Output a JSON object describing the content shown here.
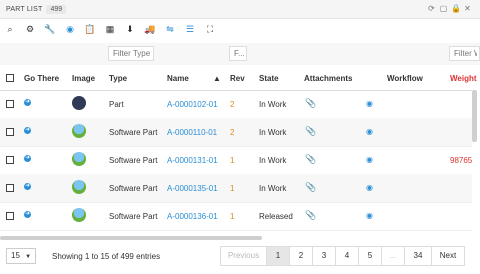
{
  "window": {
    "title": "PART LIST",
    "count": "499"
  },
  "toolbar": {
    "icons": [
      "search-icon",
      "gear-icon",
      "wrench-icon",
      "eye-icon",
      "clipboard-icon",
      "grid-icon",
      "download-icon",
      "truck-icon",
      "share-icon",
      "list-icon",
      "expand-icon"
    ]
  },
  "filters": {
    "type_placeholder": "Filter Type",
    "name_placeholder": "F...",
    "weight_placeholder": "Filter W"
  },
  "columns": {
    "go_there": "Go There",
    "image": "Image",
    "type": "Type",
    "name": "Name",
    "rev": "Rev",
    "state": "State",
    "attachments": "Attachments",
    "workflow": "Workflow",
    "weight": "Weight"
  },
  "rows": [
    {
      "type": "Part",
      "name": "A-0000102-01",
      "rev": "2",
      "state": "In Work",
      "weight": "",
      "image": "robot"
    },
    {
      "type": "Software Part",
      "name": "A-0000110-01",
      "rev": "2",
      "state": "In Work",
      "weight": "",
      "image": "globe"
    },
    {
      "type": "Software Part",
      "name": "A-0000131-01",
      "rev": "1",
      "state": "In Work",
      "weight": "98765",
      "image": "globe"
    },
    {
      "type": "Software Part",
      "name": "A-0000135-01",
      "rev": "1",
      "state": "In Work",
      "weight": "",
      "image": "globe"
    },
    {
      "type": "Software Part",
      "name": "A-0000136-01",
      "rev": "1",
      "state": "Released",
      "weight": "",
      "image": "globe"
    }
  ],
  "pager": {
    "page_size": "15",
    "summary": "Showing 1 to 15 of 499 entries",
    "previous": "Previous",
    "pages": [
      "1",
      "2",
      "3",
      "4",
      "5",
      "...",
      "34"
    ],
    "next": "Next"
  },
  "colors": {
    "accent": "#2a8fd6",
    "rev": "#e08a1e",
    "weight": "#d33333"
  }
}
